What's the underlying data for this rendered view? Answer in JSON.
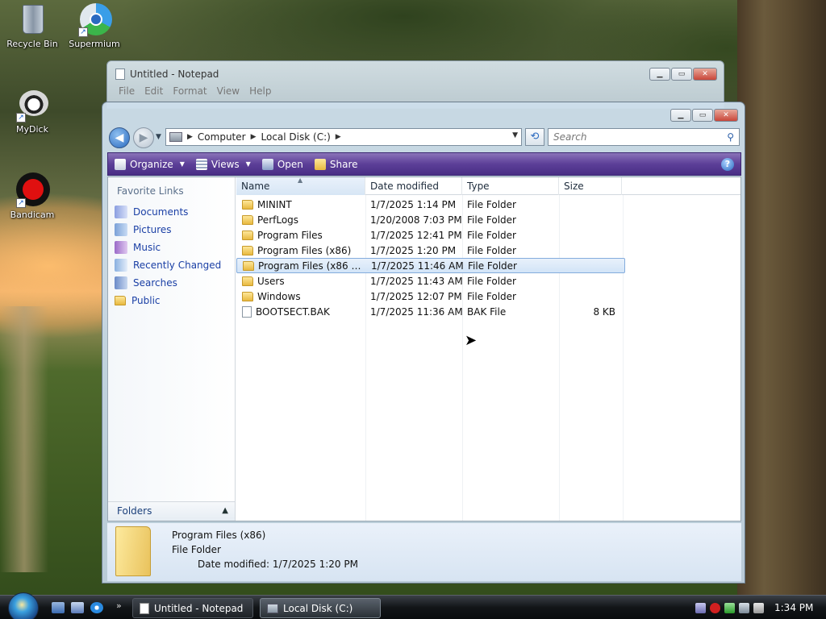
{
  "desktop": {
    "icons": [
      {
        "label": "Recycle Bin"
      },
      {
        "label": "Supermium"
      },
      {
        "label": "MyDick"
      },
      {
        "label": "Bandicam"
      }
    ]
  },
  "notepad": {
    "title": "Untitled - Notepad",
    "menu": [
      "File",
      "Edit",
      "Format",
      "View",
      "Help"
    ]
  },
  "explorer": {
    "address": {
      "crumbs": [
        "Computer",
        "Local Disk (C:)"
      ]
    },
    "search": {
      "placeholder": "Search"
    },
    "toolbar": {
      "organize": "Organize",
      "views": "Views",
      "open": "Open",
      "share": "Share"
    },
    "favorite_links_title": "Favorite Links",
    "favorites": [
      "Documents",
      "Pictures",
      "Music",
      "Recently Changed",
      "Searches",
      "Public"
    ],
    "folders_label": "Folders",
    "columns": {
      "name": "Name",
      "date": "Date modified",
      "type": "Type",
      "size": "Size"
    },
    "files": [
      {
        "name": "MININT",
        "date": "1/7/2025 1:14 PM",
        "type": "File Folder",
        "size": ""
      },
      {
        "name": "PerfLogs",
        "date": "1/20/2008 7:03 PM",
        "type": "File Folder",
        "size": ""
      },
      {
        "name": "Program Files",
        "date": "1/7/2025 12:41 PM",
        "type": "File Folder",
        "size": ""
      },
      {
        "name": "Program Files (x86)",
        "date": "1/7/2025 1:20 PM",
        "type": "File Folder",
        "size": ""
      },
      {
        "name": "Program Files (x86 My...",
        "date": "1/7/2025 11:46 AM",
        "type": "File Folder",
        "size": ""
      },
      {
        "name": "Users",
        "date": "1/7/2025 11:43 AM",
        "type": "File Folder",
        "size": ""
      },
      {
        "name": "Windows",
        "date": "1/7/2025 12:07 PM",
        "type": "File Folder",
        "size": ""
      },
      {
        "name": "BOOTSECT.BAK",
        "date": "1/7/2025 11:36 AM",
        "type": "BAK File",
        "size": "8 KB"
      }
    ],
    "details": {
      "name": "Program Files (x86)",
      "type": "File Folder",
      "modified": "Date modified: 1/7/2025 1:20 PM"
    }
  },
  "taskbar": {
    "buttons": [
      "Untitled - Notepad",
      "Local Disk (C:)"
    ],
    "clock": "1:34 PM"
  }
}
